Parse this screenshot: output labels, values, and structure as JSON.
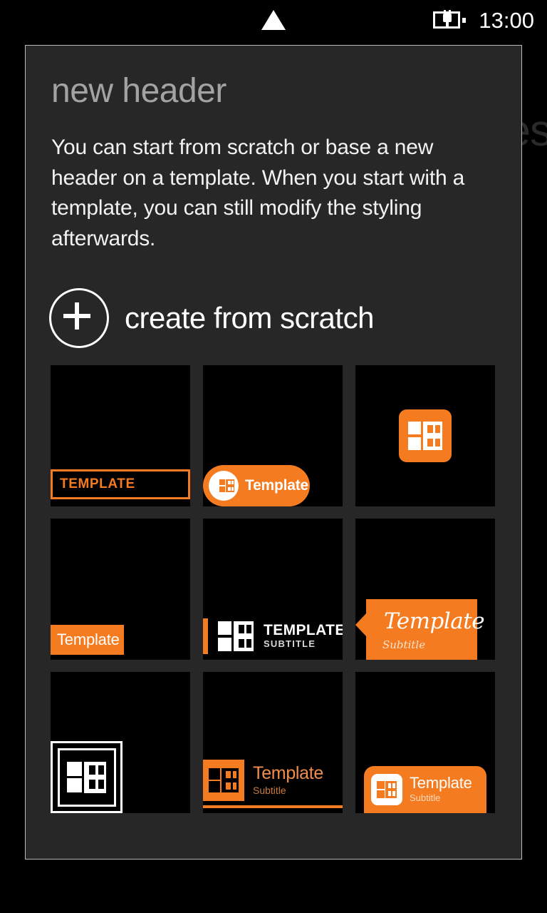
{
  "status_bar": {
    "center_icon": "triangle-up-icon",
    "battery_icon": "battery-charging-icon",
    "clock": "13:00"
  },
  "background": {
    "page_title_fragment": "es"
  },
  "dialog": {
    "title": "new header",
    "body": "You can start from scratch or base a new header on a template. When you start with a template, you can still modify the styling afterwards.",
    "create_from_scratch": {
      "icon": "plus-circle-icon",
      "label": "create from scratch"
    }
  },
  "colors": {
    "accent_orange": "#F47B20",
    "dialog_background": "#272727",
    "dialog_border": "#b9b9b9",
    "tile_background": "#000000",
    "page_background": "#000000",
    "title_text": "#a3a3a3",
    "body_text": "#f2f2f2"
  },
  "templates": [
    {
      "id": "template-outlined-bar",
      "logo": "none",
      "title": "TEMPLATE",
      "subtitle": ""
    },
    {
      "id": "template-orange-pill",
      "logo": "h-grid-icon",
      "title": "Template",
      "subtitle": ""
    },
    {
      "id": "template-centered-logo",
      "logo": "h-grid-icon",
      "title": "",
      "subtitle": ""
    },
    {
      "id": "template-orange-block",
      "logo": "none",
      "title": "Template",
      "subtitle": ""
    },
    {
      "id": "template-accent-bar-logo",
      "logo": "h-grid-icon",
      "title": "TEMPLATE",
      "subtitle": "SUBTITLE"
    },
    {
      "id": "template-speech-bubble",
      "logo": "none",
      "title": "Template",
      "subtitle": "Subtitle"
    },
    {
      "id": "template-framed-logo",
      "logo": "h-grid-icon",
      "title": "",
      "subtitle": ""
    },
    {
      "id": "template-logo-block-rule",
      "logo": "h-grid-icon",
      "title": "Template",
      "subtitle": "Subtitle"
    },
    {
      "id": "template-rounded-banner",
      "logo": "h-grid-icon",
      "title": "Template",
      "subtitle": "Subtitle"
    }
  ]
}
